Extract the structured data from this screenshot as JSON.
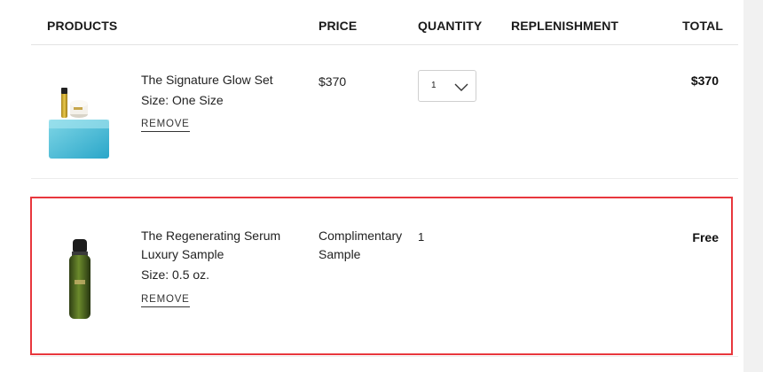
{
  "header": {
    "products": "PRODUCTS",
    "price": "PRICE",
    "quantity": "QUANTITY",
    "replenishment": "REPLENISHMENT",
    "total": "TOTAL"
  },
  "items": [
    {
      "name": "The Signature Glow Set",
      "size": "Size: One Size",
      "remove": "REMOVE",
      "price": "$370",
      "quantity": "1",
      "total": "$370",
      "image_icon": "skincare-set-image"
    },
    {
      "name_line1": "The Regenerating Serum",
      "name_line2": "Luxury Sample",
      "size": "Size: 0.5 oz.",
      "remove": "REMOVE",
      "price_line1": "Complimentary",
      "price_line2": "Sample",
      "quantity": "1",
      "total": "Free",
      "image_icon": "serum-bottle-image"
    }
  ],
  "colors": {
    "highlight_border": "#e8373d",
    "divider": "#e3e3e3"
  }
}
